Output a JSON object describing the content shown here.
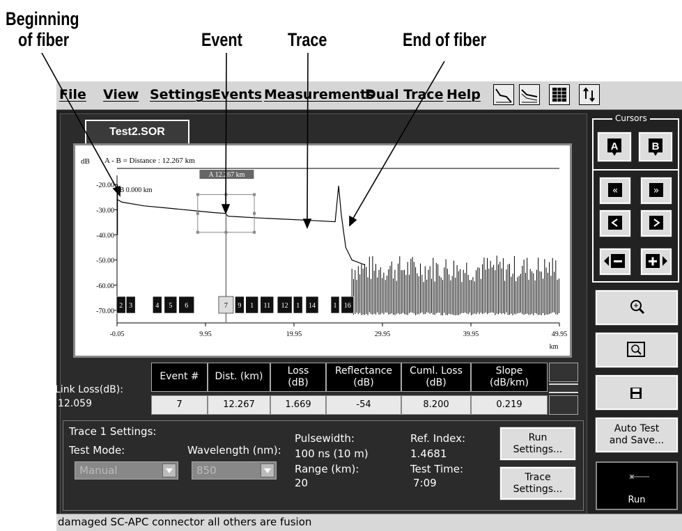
{
  "callouts": {
    "beginning_line1": "Beginning",
    "beginning_line2": "of fiber",
    "event": "Event",
    "trace": "Trace",
    "end": "End of fiber"
  },
  "menu": [
    "File",
    "View",
    "Settings",
    "Events",
    "Measurements",
    "Dual Trace",
    "Help"
  ],
  "toolbar_icons": [
    "trace-view-icon",
    "multi-trace-icon",
    "table-grid-icon",
    "swap-icon"
  ],
  "tab": {
    "label": "Test2.SOR"
  },
  "plot": {
    "ylabel": "dB",
    "distance_text": "A - B =  Distance : 12.267 km",
    "cursor_a_label": "A 12.267 km",
    "cursor_b_label": "B 0.000 km",
    "y_ticks": [
      "-20.00",
      "-30.00",
      "-40.00",
      "-50.00",
      "-60.00",
      "-70.00"
    ],
    "x_ticks": [
      "-0.05",
      "9.95",
      "19.95",
      "29.95",
      "39.95",
      "49.95"
    ],
    "x_unit": "km",
    "event_markers": [
      "2",
      "3",
      "4",
      "5",
      "6",
      "7",
      "9",
      "1",
      "11",
      "12",
      "1",
      "14",
      "1",
      "16"
    ]
  },
  "chart_data": {
    "type": "line",
    "title": "",
    "xlabel": "km",
    "ylabel": "dB",
    "xlim": [
      -0.05,
      49.95
    ],
    "ylim": [
      -75,
      -15
    ],
    "series": [
      {
        "x": [
          0,
          0.5,
          3,
          6,
          9,
          11,
          12.2,
          12.5,
          13.5,
          16,
          19,
          22,
          24.6,
          25.0,
          25.3,
          25.8,
          26.5,
          28
        ],
        "y": [
          -26,
          -27,
          -28.5,
          -29.5,
          -30.5,
          -31.2,
          -31.5,
          -32.6,
          -32.8,
          -33.3,
          -33.8,
          -34.3,
          -34.8,
          -20.5,
          -32,
          -45,
          -50,
          -52
        ]
      }
    ],
    "noise_region": {
      "x_start": 26.5,
      "x_end": 49.95,
      "y_low": -72,
      "y_high": -48
    },
    "cursor_a": 12.267,
    "cursor_b": 0.0
  },
  "table": {
    "link_loss_label": "Link Loss(dB):",
    "link_loss_value": "12.059",
    "headers": [
      "Event #",
      "Dist. (km)",
      "Loss\n(dB)",
      "Reflectance\n(dB)",
      "Cuml. Loss\n(dB)",
      "Slope\n(dB/km)"
    ],
    "values": [
      "7",
      "12.267",
      "1.669",
      "-54",
      "8.200",
      "0.219"
    ]
  },
  "settings": {
    "title": "Trace 1 Settings:",
    "test_mode_label": "Test Mode:",
    "test_mode_value": "Manual",
    "wavelength_label": "Wavelength (nm):",
    "wavelength_value": "850",
    "pulsewidth_label": "Pulsewidth:",
    "pulsewidth_value": "100 ns (10 m)",
    "range_label": "Range (km):",
    "range_value": "20",
    "ref_index_label": "Ref. Index:",
    "ref_index_value": "1.4681",
    "test_time_label": "Test Time:",
    "test_time_value": "7:09",
    "run_settings_button": "Run\nSettings...",
    "trace_settings_button": "Trace\nSettings..."
  },
  "side": {
    "cursors_label": "Cursors",
    "cursor_a": "A",
    "cursor_b": "B",
    "auto_test_button": "Auto Test\nand Save...",
    "run_button": "Run"
  },
  "status": "damaged SC-APC connector all others are fusion"
}
